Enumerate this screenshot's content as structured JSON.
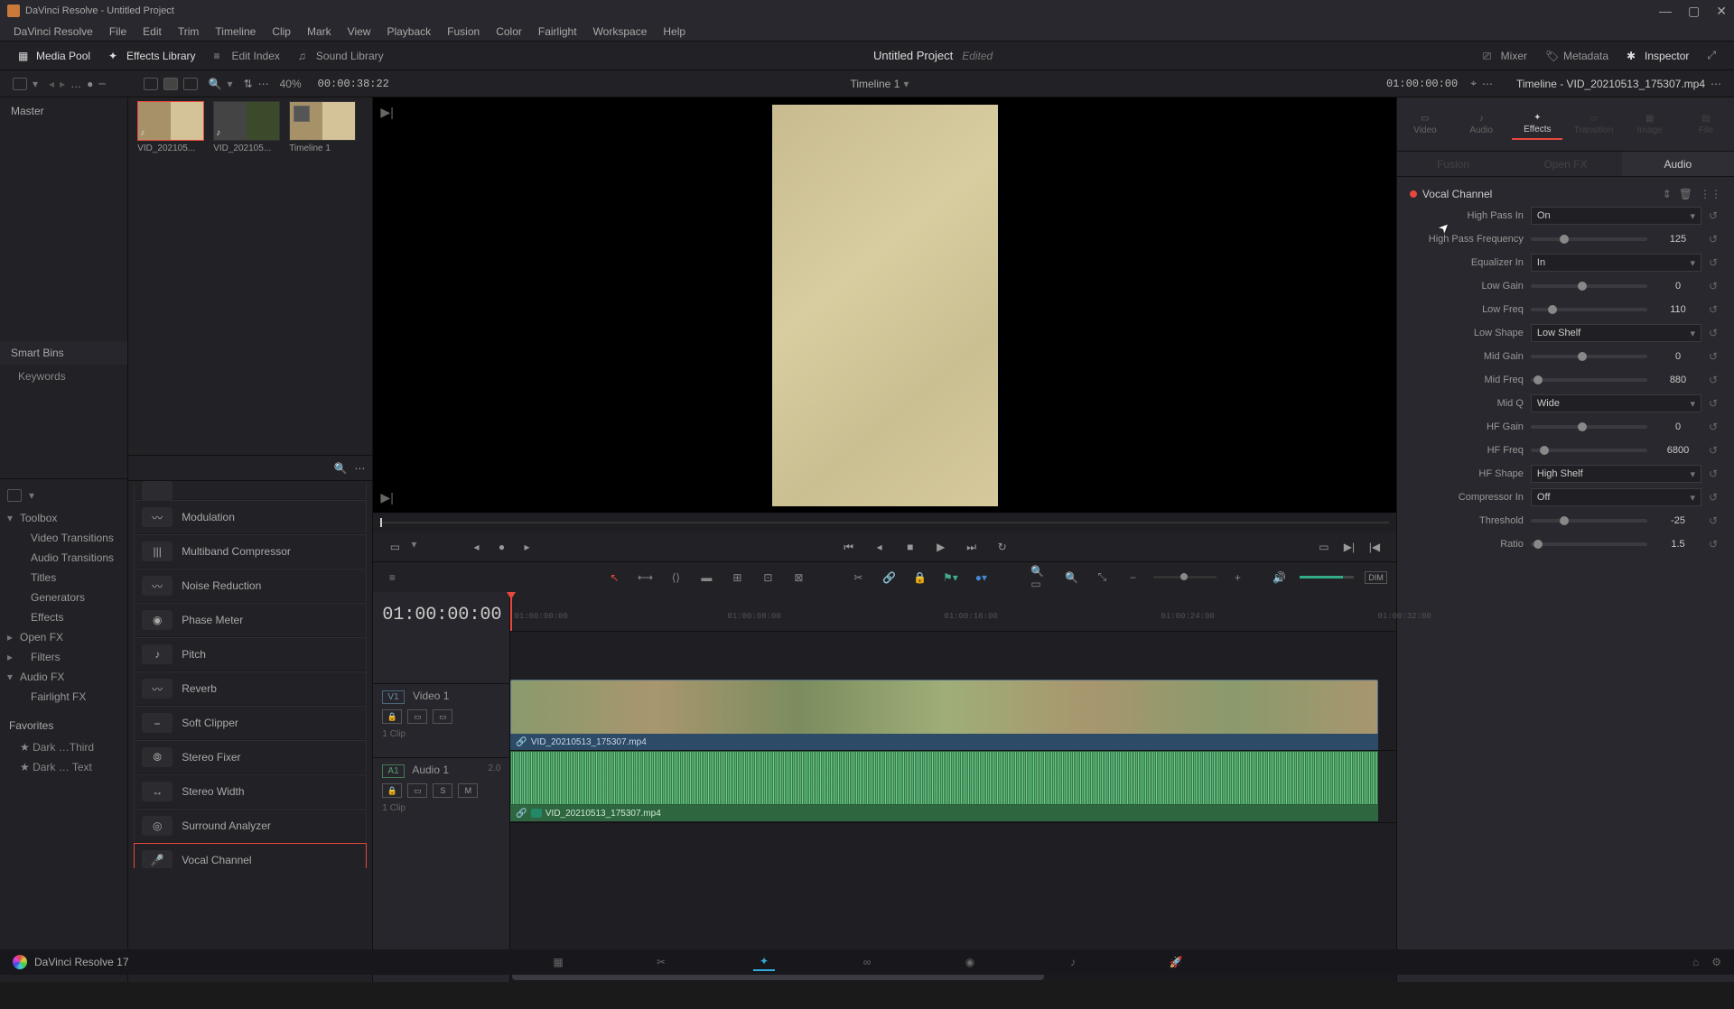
{
  "window": {
    "title": "DaVinci Resolve - Untitled Project"
  },
  "menu": [
    "DaVinci Resolve",
    "File",
    "Edit",
    "Trim",
    "Timeline",
    "Clip",
    "Mark",
    "View",
    "Playback",
    "Fusion",
    "Color",
    "Fairlight",
    "Workspace",
    "Help"
  ],
  "panels": {
    "media_pool": "Media Pool",
    "effects_library": "Effects Library",
    "edit_index": "Edit Index",
    "sound_library": "Sound Library",
    "mixer": "Mixer",
    "metadata": "Metadata",
    "inspector": "Inspector"
  },
  "project": {
    "title": "Untitled Project",
    "edited": "Edited"
  },
  "subbar": {
    "zoom": "40%",
    "timecode": "00:00:38:22"
  },
  "bins": {
    "master": "Master",
    "smart_bins": "Smart Bins",
    "keywords": "Keywords"
  },
  "pool_thumbs": [
    {
      "label": "VID_202105...",
      "music": true,
      "selected": true,
      "kind": "clip_sand"
    },
    {
      "label": "VID_202105...",
      "music": true,
      "kind": "clip_green"
    },
    {
      "label": "Timeline 1",
      "kind": "timeline"
    }
  ],
  "fx_tree": {
    "toolbox": "Toolbox",
    "video_transitions": "Video Transitions",
    "audio_transitions": "Audio Transitions",
    "titles": "Titles",
    "generators": "Generators",
    "effects": "Effects",
    "open_fx": "Open FX",
    "filters": "Filters",
    "audio_fx": "Audio FX",
    "fairlight_fx": "Fairlight FX",
    "favorites": "Favorites",
    "fav1": "Dark …Third",
    "fav2": "Dark … Text"
  },
  "fx_list": [
    "Modulation",
    "Multiband Compressor",
    "Noise Reduction",
    "Phase Meter",
    "Pitch",
    "Reverb",
    "Soft Clipper",
    "Stereo Fixer",
    "Stereo Width",
    "Surround Analyzer",
    "Vocal Channel"
  ],
  "viewer": {
    "timeline_name": "Timeline 1",
    "start_tc": "01:00:00:00"
  },
  "inspector_header": "Timeline - VID_20210513_175307.mp4",
  "inspector_tabs": {
    "video": "Video",
    "audio": "Audio",
    "effects": "Effects",
    "transition": "Transition",
    "image": "Image",
    "file": "File"
  },
  "inspector_subtabs": {
    "fusion": "Fusion",
    "openfx": "Open FX",
    "audio": "Audio"
  },
  "effect": {
    "name": "Vocal Channel",
    "params": {
      "high_pass_in_lbl": "High Pass In",
      "high_pass_in": "On",
      "high_pass_freq_lbl": "High Pass Frequency",
      "high_pass_freq": "125",
      "equalizer_in_lbl": "Equalizer In",
      "equalizer_in": "In",
      "low_gain_lbl": "Low Gain",
      "low_gain": "0",
      "low_freq_lbl": "Low Freq",
      "low_freq": "110",
      "low_shape_lbl": "Low Shape",
      "low_shape": "Low Shelf",
      "mid_gain_lbl": "Mid Gain",
      "mid_gain": "0",
      "mid_freq_lbl": "Mid Freq",
      "mid_freq": "880",
      "mid_q_lbl": "Mid Q",
      "mid_q": "Wide",
      "hf_gain_lbl": "HF Gain",
      "hf_gain": "0",
      "hf_freq_lbl": "HF Freq",
      "hf_freq": "6800",
      "hf_shape_lbl": "HF Shape",
      "hf_shape": "High Shelf",
      "compressor_in_lbl": "Compressor In",
      "compressor_in": "Off",
      "threshold_lbl": "Threshold",
      "threshold": "-25",
      "ratio_lbl": "Ratio",
      "ratio": "1.5"
    }
  },
  "timeline": {
    "tc_display": "01:00:00:00",
    "video_track": "Video 1",
    "v_badge": "V1",
    "v_clips": "1 Clip",
    "audio_track": "Audio 1",
    "a_badge": "A1",
    "a_meter": "2.0",
    "a_clips": "1 Clip",
    "clip_name": "VID_20210513_175307.mp4",
    "ruler_ticks": [
      "01:00:00:00",
      "01:00:08:00",
      "01:00:16:00",
      "01:00:24:00",
      "01:00:32:00"
    ],
    "solo": "S",
    "mute": "M"
  },
  "brand": "DaVinci Resolve 17",
  "dim": "DIM"
}
